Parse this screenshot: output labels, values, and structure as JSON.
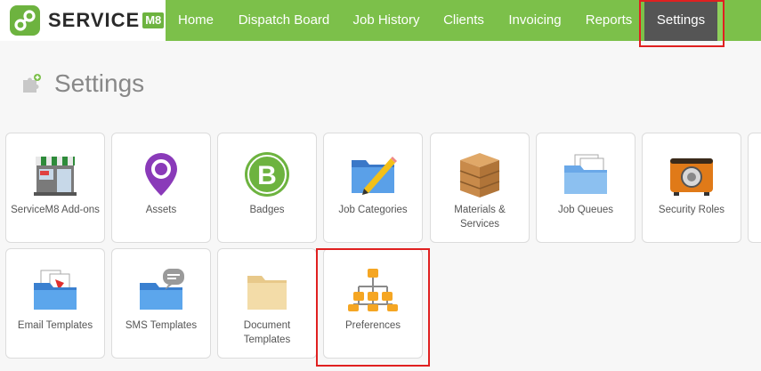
{
  "logo": {
    "text": "SERVICE",
    "suffix": "M8"
  },
  "nav": {
    "items": [
      {
        "label": "Home"
      },
      {
        "label": "Dispatch Board"
      },
      {
        "label": "Job History"
      },
      {
        "label": "Clients"
      },
      {
        "label": "Invoicing"
      },
      {
        "label": "Reports"
      },
      {
        "label": "Settings",
        "active": true
      }
    ]
  },
  "page": {
    "title": "Settings"
  },
  "tiles": [
    {
      "label": "ServiceM8 Add-ons",
      "icon": "store-icon"
    },
    {
      "label": "Assets",
      "icon": "location-pin-icon"
    },
    {
      "label": "Badges",
      "icon": "badge-b-icon"
    },
    {
      "label": "Job Categories",
      "icon": "folder-pencil-icon"
    },
    {
      "label": "Materials & Services",
      "icon": "crate-icon"
    },
    {
      "label": "Job Queues",
      "icon": "folder-documents-icon"
    },
    {
      "label": "Security Roles",
      "icon": "safe-icon"
    },
    {
      "label": "Email Templates",
      "icon": "email-folder-icon"
    },
    {
      "label": "SMS Templates",
      "icon": "sms-folder-icon"
    },
    {
      "label": "Document Templates",
      "icon": "folder-icon"
    },
    {
      "label": "Preferences",
      "icon": "hierarchy-icon"
    }
  ],
  "colors": {
    "nav_bg": "#7cc04a",
    "nav_active_bg": "#555555",
    "highlight": "#e02020",
    "brand": "#6db33f"
  }
}
